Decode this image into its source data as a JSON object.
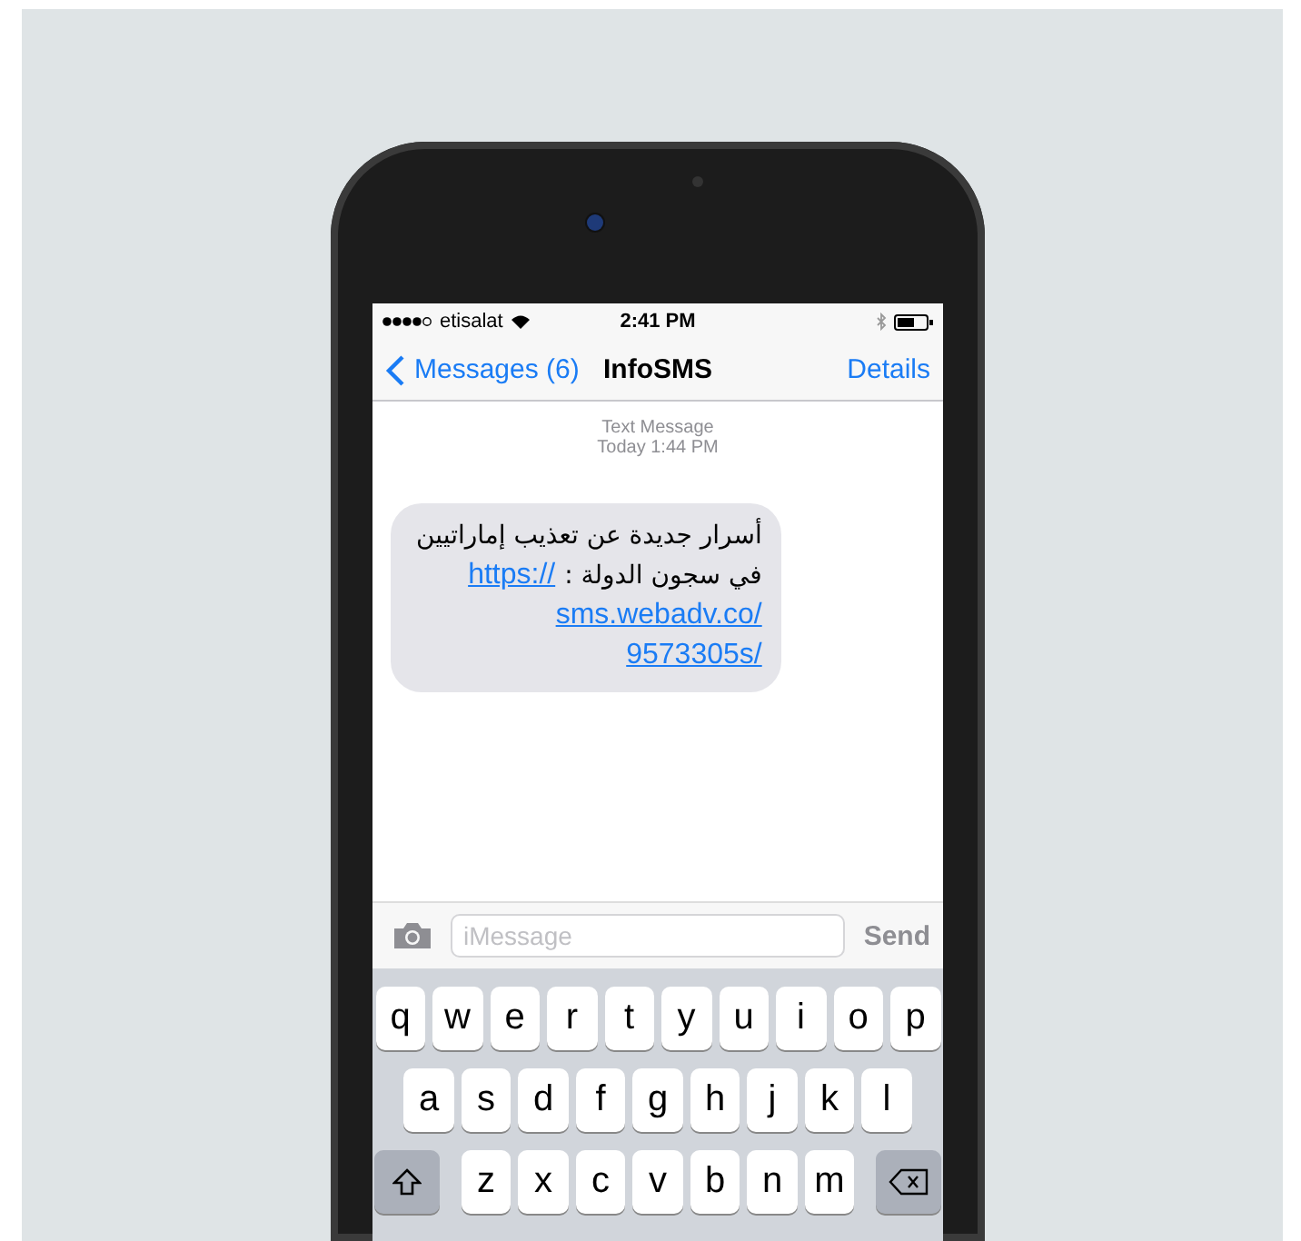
{
  "status_bar": {
    "carrier": "etisalat",
    "time": "2:41 PM"
  },
  "nav": {
    "back": "Messages (6)",
    "title": "InfoSMS",
    "action": "Details"
  },
  "thread": {
    "label": "Text Message",
    "timestamp": "Today 1:44 PM"
  },
  "messages": [
    {
      "text_lines": [
        "أسرار جديدة عن تعذيب إماراتيين",
        "في سجون الدولة :"
      ],
      "link_lines": [
        "https://",
        "sms.webadv.co/",
        "9573305s/"
      ]
    }
  ],
  "composer": {
    "placeholder": "iMessage",
    "send": "Send"
  },
  "keyboard": {
    "rows": [
      [
        "q",
        "w",
        "e",
        "r",
        "t",
        "y",
        "u",
        "i",
        "o",
        "p"
      ],
      [
        "a",
        "s",
        "d",
        "f",
        "g",
        "h",
        "j",
        "k",
        "l"
      ],
      [
        "z",
        "x",
        "c",
        "v",
        "b",
        "n",
        "m"
      ]
    ]
  }
}
